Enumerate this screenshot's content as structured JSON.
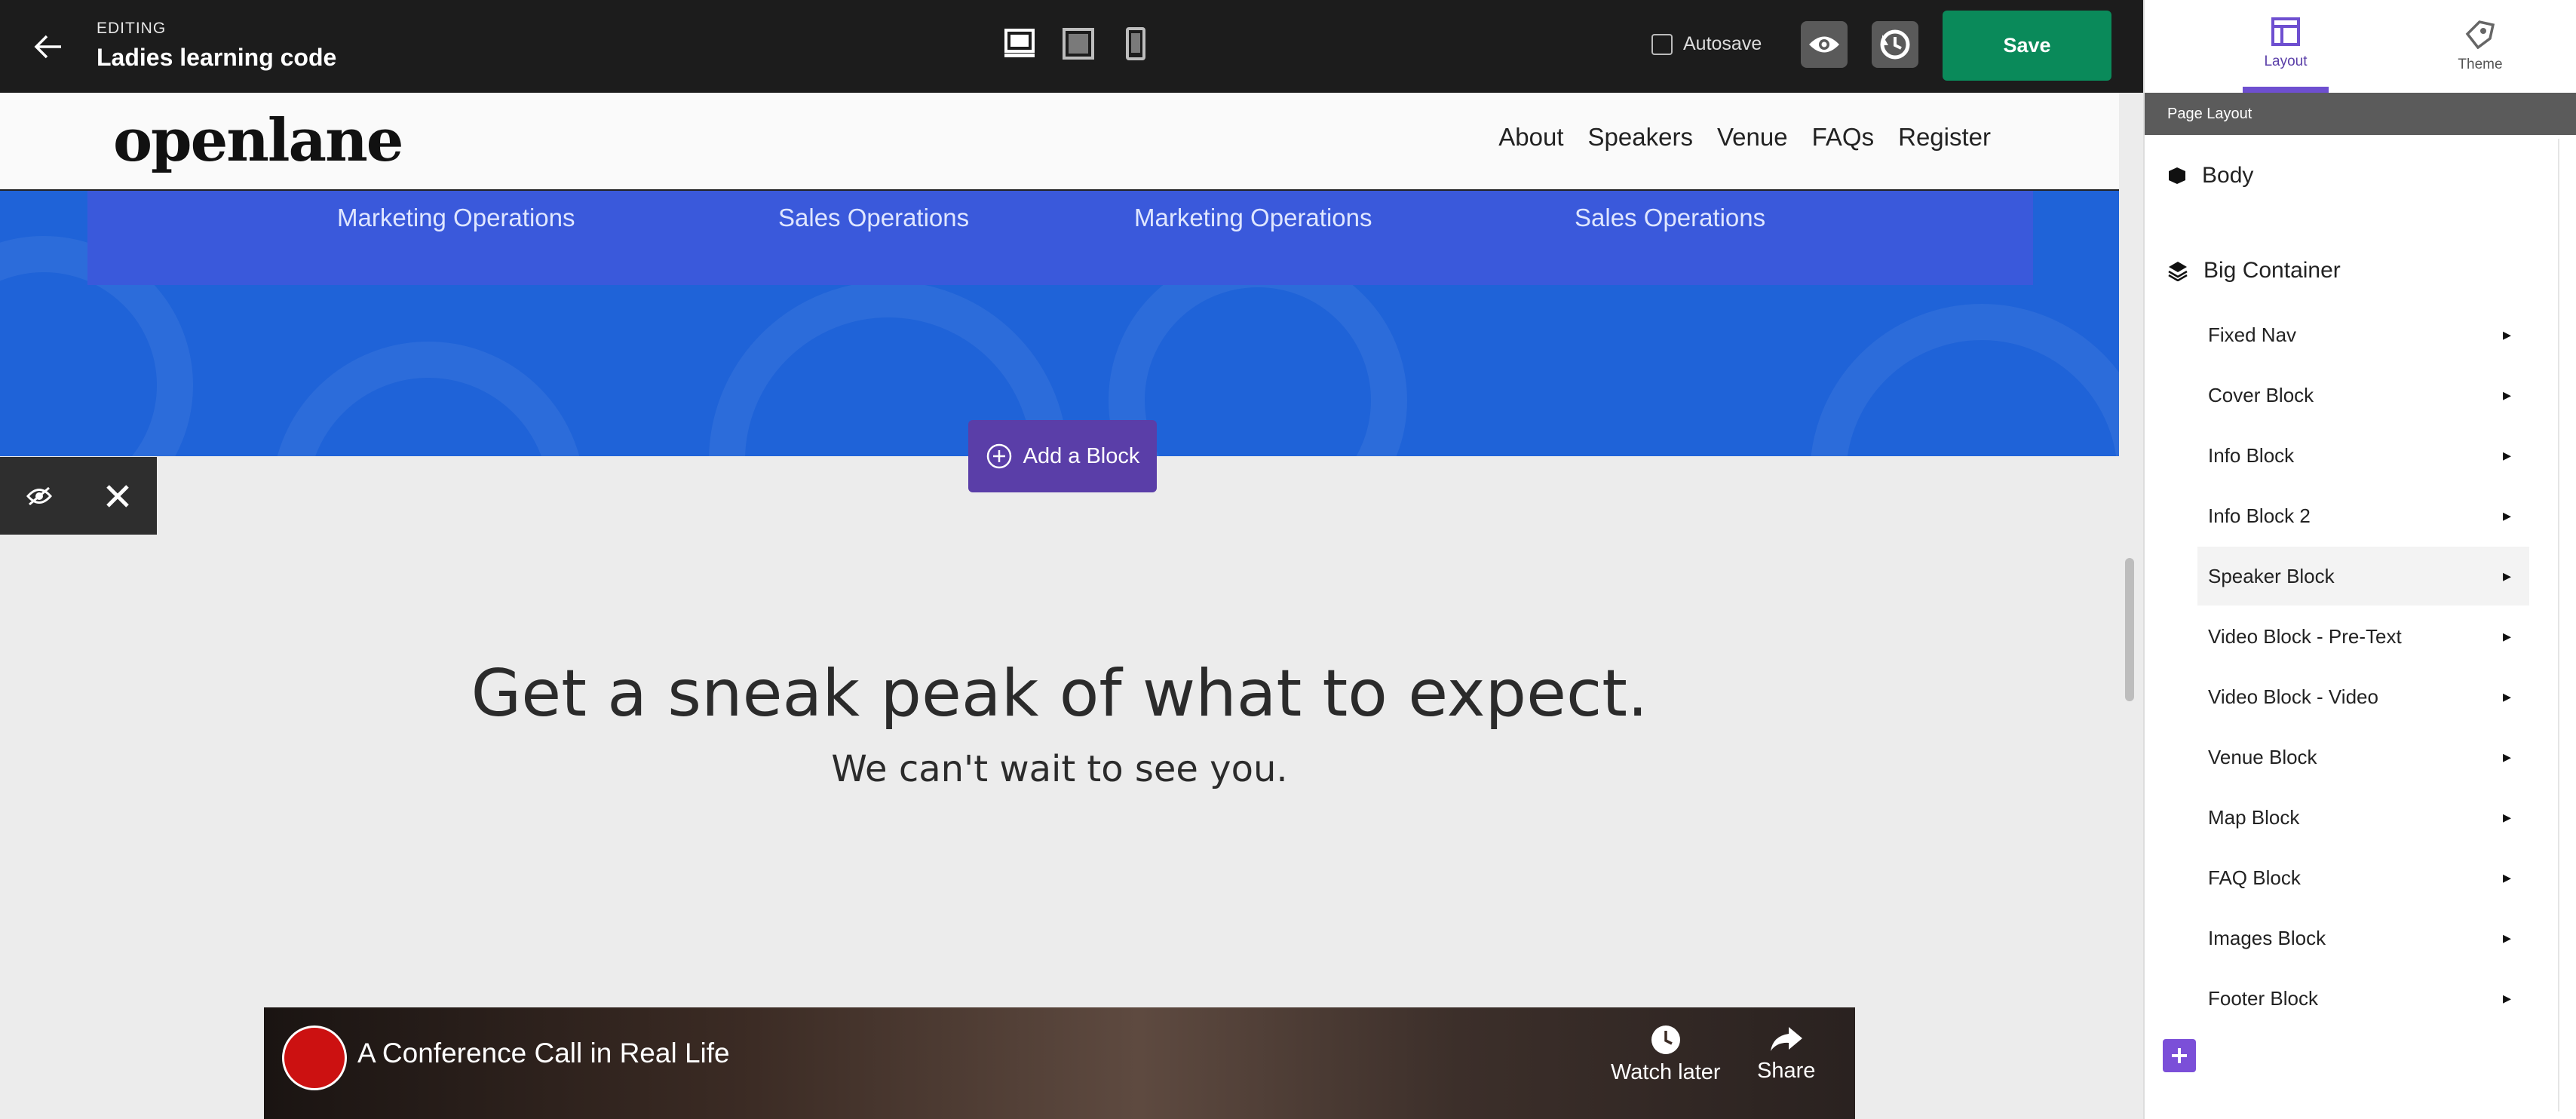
{
  "editor": {
    "mode_label": "EDITING",
    "page_title": "Ladies learning code",
    "autosave_label": "Autosave",
    "save_label": "Save"
  },
  "site": {
    "logo": "openlane",
    "nav": [
      "About",
      "Speakers",
      "Venue",
      "FAQs",
      "Register"
    ],
    "roles": [
      "Marketing Operations",
      "Sales Operations",
      "Marketing Operations",
      "Sales Operations"
    ],
    "add_block_label": "Add a Block",
    "headline": "Get a sneak peak of what to expect.",
    "subheadline": "We can't wait to see you.",
    "video": {
      "title": "A Conference Call in Real Life",
      "watch_later": "Watch later",
      "share": "Share"
    }
  },
  "panel": {
    "tabs": [
      "Layout",
      "Theme"
    ],
    "section_title": "Page Layout",
    "body_label": "Body",
    "container_label": "Big Container",
    "blocks": [
      "Fixed Nav",
      "Cover Block",
      "Info Block",
      "Info Block 2",
      "Speaker Block",
      "Video Block - Pre-Text",
      "Video Block - Video",
      "Venue Block",
      "Map Block",
      "FAQ Block",
      "Images Block",
      "Footer Block"
    ]
  },
  "colors": {
    "save": "#0a8a5a",
    "accent": "#6e4fd0",
    "blue_section": "#1f63d8"
  }
}
